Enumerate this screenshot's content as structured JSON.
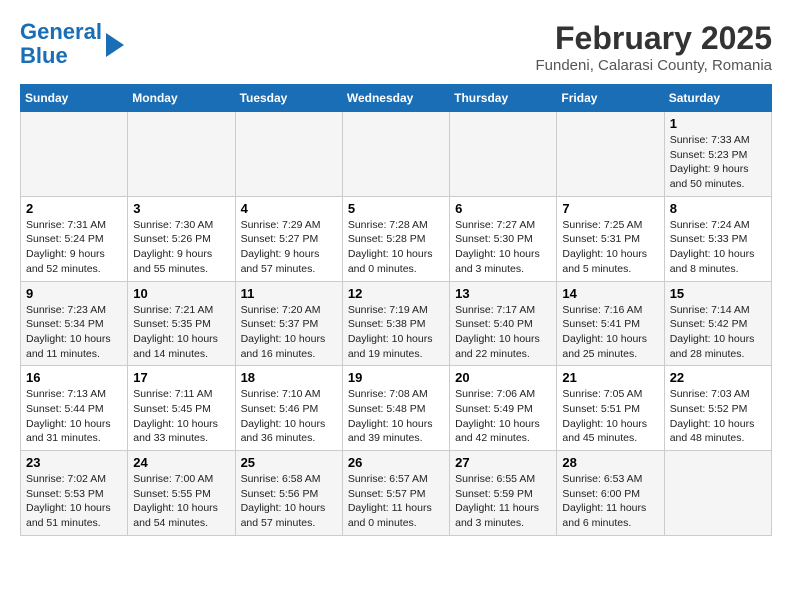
{
  "header": {
    "logo_line1": "General",
    "logo_line2": "Blue",
    "month_title": "February 2025",
    "subtitle": "Fundeni, Calarasi County, Romania"
  },
  "weekdays": [
    "Sunday",
    "Monday",
    "Tuesday",
    "Wednesday",
    "Thursday",
    "Friday",
    "Saturday"
  ],
  "weeks": [
    [
      {
        "day": "",
        "info": ""
      },
      {
        "day": "",
        "info": ""
      },
      {
        "day": "",
        "info": ""
      },
      {
        "day": "",
        "info": ""
      },
      {
        "day": "",
        "info": ""
      },
      {
        "day": "",
        "info": ""
      },
      {
        "day": "1",
        "info": "Sunrise: 7:33 AM\nSunset: 5:23 PM\nDaylight: 9 hours\nand 50 minutes."
      }
    ],
    [
      {
        "day": "2",
        "info": "Sunrise: 7:31 AM\nSunset: 5:24 PM\nDaylight: 9 hours\nand 52 minutes."
      },
      {
        "day": "3",
        "info": "Sunrise: 7:30 AM\nSunset: 5:26 PM\nDaylight: 9 hours\nand 55 minutes."
      },
      {
        "day": "4",
        "info": "Sunrise: 7:29 AM\nSunset: 5:27 PM\nDaylight: 9 hours\nand 57 minutes."
      },
      {
        "day": "5",
        "info": "Sunrise: 7:28 AM\nSunset: 5:28 PM\nDaylight: 10 hours\nand 0 minutes."
      },
      {
        "day": "6",
        "info": "Sunrise: 7:27 AM\nSunset: 5:30 PM\nDaylight: 10 hours\nand 3 minutes."
      },
      {
        "day": "7",
        "info": "Sunrise: 7:25 AM\nSunset: 5:31 PM\nDaylight: 10 hours\nand 5 minutes."
      },
      {
        "day": "8",
        "info": "Sunrise: 7:24 AM\nSunset: 5:33 PM\nDaylight: 10 hours\nand 8 minutes."
      }
    ],
    [
      {
        "day": "9",
        "info": "Sunrise: 7:23 AM\nSunset: 5:34 PM\nDaylight: 10 hours\nand 11 minutes."
      },
      {
        "day": "10",
        "info": "Sunrise: 7:21 AM\nSunset: 5:35 PM\nDaylight: 10 hours\nand 14 minutes."
      },
      {
        "day": "11",
        "info": "Sunrise: 7:20 AM\nSunset: 5:37 PM\nDaylight: 10 hours\nand 16 minutes."
      },
      {
        "day": "12",
        "info": "Sunrise: 7:19 AM\nSunset: 5:38 PM\nDaylight: 10 hours\nand 19 minutes."
      },
      {
        "day": "13",
        "info": "Sunrise: 7:17 AM\nSunset: 5:40 PM\nDaylight: 10 hours\nand 22 minutes."
      },
      {
        "day": "14",
        "info": "Sunrise: 7:16 AM\nSunset: 5:41 PM\nDaylight: 10 hours\nand 25 minutes."
      },
      {
        "day": "15",
        "info": "Sunrise: 7:14 AM\nSunset: 5:42 PM\nDaylight: 10 hours\nand 28 minutes."
      }
    ],
    [
      {
        "day": "16",
        "info": "Sunrise: 7:13 AM\nSunset: 5:44 PM\nDaylight: 10 hours\nand 31 minutes."
      },
      {
        "day": "17",
        "info": "Sunrise: 7:11 AM\nSunset: 5:45 PM\nDaylight: 10 hours\nand 33 minutes."
      },
      {
        "day": "18",
        "info": "Sunrise: 7:10 AM\nSunset: 5:46 PM\nDaylight: 10 hours\nand 36 minutes."
      },
      {
        "day": "19",
        "info": "Sunrise: 7:08 AM\nSunset: 5:48 PM\nDaylight: 10 hours\nand 39 minutes."
      },
      {
        "day": "20",
        "info": "Sunrise: 7:06 AM\nSunset: 5:49 PM\nDaylight: 10 hours\nand 42 minutes."
      },
      {
        "day": "21",
        "info": "Sunrise: 7:05 AM\nSunset: 5:51 PM\nDaylight: 10 hours\nand 45 minutes."
      },
      {
        "day": "22",
        "info": "Sunrise: 7:03 AM\nSunset: 5:52 PM\nDaylight: 10 hours\nand 48 minutes."
      }
    ],
    [
      {
        "day": "23",
        "info": "Sunrise: 7:02 AM\nSunset: 5:53 PM\nDaylight: 10 hours\nand 51 minutes."
      },
      {
        "day": "24",
        "info": "Sunrise: 7:00 AM\nSunset: 5:55 PM\nDaylight: 10 hours\nand 54 minutes."
      },
      {
        "day": "25",
        "info": "Sunrise: 6:58 AM\nSunset: 5:56 PM\nDaylight: 10 hours\nand 57 minutes."
      },
      {
        "day": "26",
        "info": "Sunrise: 6:57 AM\nSunset: 5:57 PM\nDaylight: 11 hours\nand 0 minutes."
      },
      {
        "day": "27",
        "info": "Sunrise: 6:55 AM\nSunset: 5:59 PM\nDaylight: 11 hours\nand 3 minutes."
      },
      {
        "day": "28",
        "info": "Sunrise: 6:53 AM\nSunset: 6:00 PM\nDaylight: 11 hours\nand 6 minutes."
      },
      {
        "day": "",
        "info": ""
      }
    ]
  ]
}
